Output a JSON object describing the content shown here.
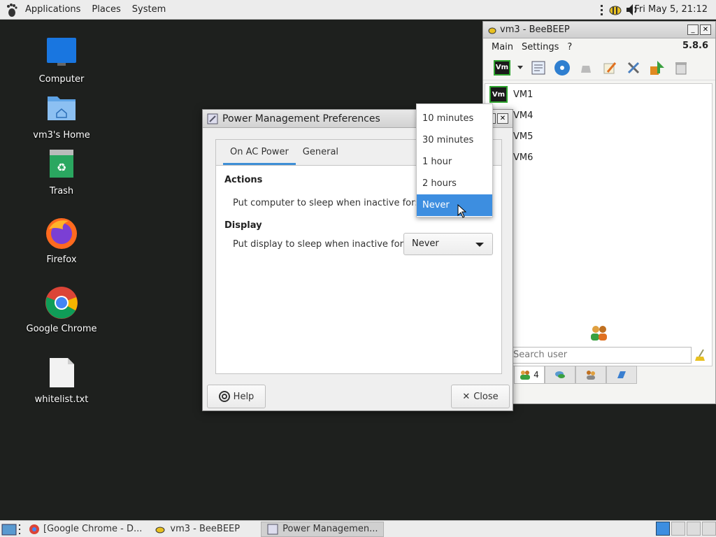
{
  "top_panel": {
    "menus": [
      "Applications",
      "Places",
      "System"
    ],
    "clock": "Fri May  5, 21:12"
  },
  "desktop_icons": [
    {
      "label": "Computer",
      "icon": "monitor-icon"
    },
    {
      "label": "vm3's Home",
      "icon": "home-folder-icon"
    },
    {
      "label": "Trash",
      "icon": "trash-icon"
    },
    {
      "label": "Firefox",
      "icon": "firefox-icon"
    },
    {
      "label": "Google Chrome",
      "icon": "chrome-icon"
    },
    {
      "label": "whitelist.txt",
      "icon": "text-file-icon"
    }
  ],
  "beebeep": {
    "title": "vm3 - BeeBEEP",
    "menu": [
      "Main",
      "Settings",
      "?"
    ],
    "version": "5.8.6",
    "users": [
      "VM1",
      "VM4",
      "VM5",
      "VM6"
    ],
    "vm_badge": "Vm",
    "search_placeholder": "Search user",
    "users_tab_count": "4"
  },
  "power_dialog": {
    "title": "Power Management Preferences",
    "tabs": [
      "On AC Power",
      "General"
    ],
    "actions_title": "Actions",
    "computer_sleep_label": "Put computer to sleep when inactive for:",
    "display_title": "Display",
    "display_sleep_label": "Put display to sleep when inactive for:",
    "display_sleep_value": "Never",
    "help_label": "Help",
    "close_label": "Close"
  },
  "sleep_dropdown": {
    "options": [
      "10 minutes",
      "30 minutes",
      "1 hour",
      "2 hours",
      "Never"
    ],
    "selected": "Never"
  },
  "taskbar": {
    "tasks": [
      "[Google Chrome - D...",
      "vm3 - BeeBEEP",
      "Power Managemen..."
    ]
  },
  "colors": {
    "accent": "#3d8ee0",
    "desktop": "#1e201e",
    "vm_border": "#2fa52f"
  }
}
